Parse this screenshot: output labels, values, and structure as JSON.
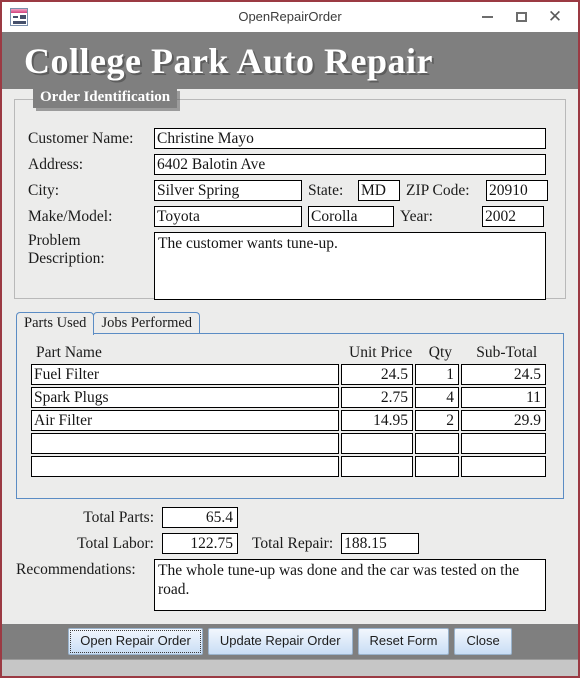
{
  "window": {
    "title": "OpenRepairOrder",
    "icon": "form-window-icon",
    "controls": {
      "minimize": "minimize-icon",
      "maximize": "maximize-icon",
      "close": "close-icon"
    },
    "border_color": "#9b3a43"
  },
  "banner": {
    "title": "College Park Auto Repair",
    "background": "#7f7f7f",
    "text_color": "#ffffff"
  },
  "order_identification": {
    "legend": "Order Identification",
    "labels": {
      "customer_name": "Customer Name:",
      "address": "Address:",
      "city": "City:",
      "state": "State:",
      "zip_code": "ZIP Code:",
      "make_model": "Make/Model:",
      "year": "Year:",
      "problem_description_line1": "Problem",
      "problem_description_line2": "Description:"
    },
    "values": {
      "customer_name": "Christine Mayo",
      "address": "6402 Balotin Ave",
      "city": "Silver Spring",
      "state": "MD",
      "zip_code": "20910",
      "make": "Toyota",
      "model": "Corolla",
      "year": "2002",
      "problem_description": "The customer wants tune-up."
    }
  },
  "tabs": [
    {
      "label": "Parts Used",
      "active": true
    },
    {
      "label": "Jobs Performed",
      "active": false
    }
  ],
  "parts_table": {
    "headers": {
      "part_name": "Part Name",
      "unit_price": "Unit Price",
      "qty": "Qty",
      "sub_total": "Sub-Total"
    },
    "rows": [
      {
        "part_name": "Fuel Filter",
        "unit_price": "24.5",
        "qty": "1",
        "sub_total": "24.5"
      },
      {
        "part_name": "Spark Plugs",
        "unit_price": "2.75",
        "qty": "4",
        "sub_total": "11"
      },
      {
        "part_name": "Air Filter",
        "unit_price": "14.95",
        "qty": "2",
        "sub_total": "29.9"
      },
      {
        "part_name": "",
        "unit_price": "",
        "qty": "",
        "sub_total": ""
      },
      {
        "part_name": "",
        "unit_price": "",
        "qty": "",
        "sub_total": ""
      }
    ]
  },
  "totals": {
    "labels": {
      "total_parts": "Total Parts:",
      "total_labor": "Total Labor:",
      "total_repair": "Total Repair:",
      "recommendations": "Recommendations:"
    },
    "values": {
      "total_parts": "65.4",
      "total_labor": "122.75",
      "total_repair": "188.15",
      "recommendations": "The whole tune-up was done and the car was tested on the road."
    }
  },
  "footer": {
    "buttons": [
      {
        "label": "Open Repair Order",
        "focused": true
      },
      {
        "label": "Update Repair Order",
        "focused": false
      },
      {
        "label": "Reset Form",
        "focused": false
      },
      {
        "label": "Close",
        "focused": false
      }
    ]
  }
}
